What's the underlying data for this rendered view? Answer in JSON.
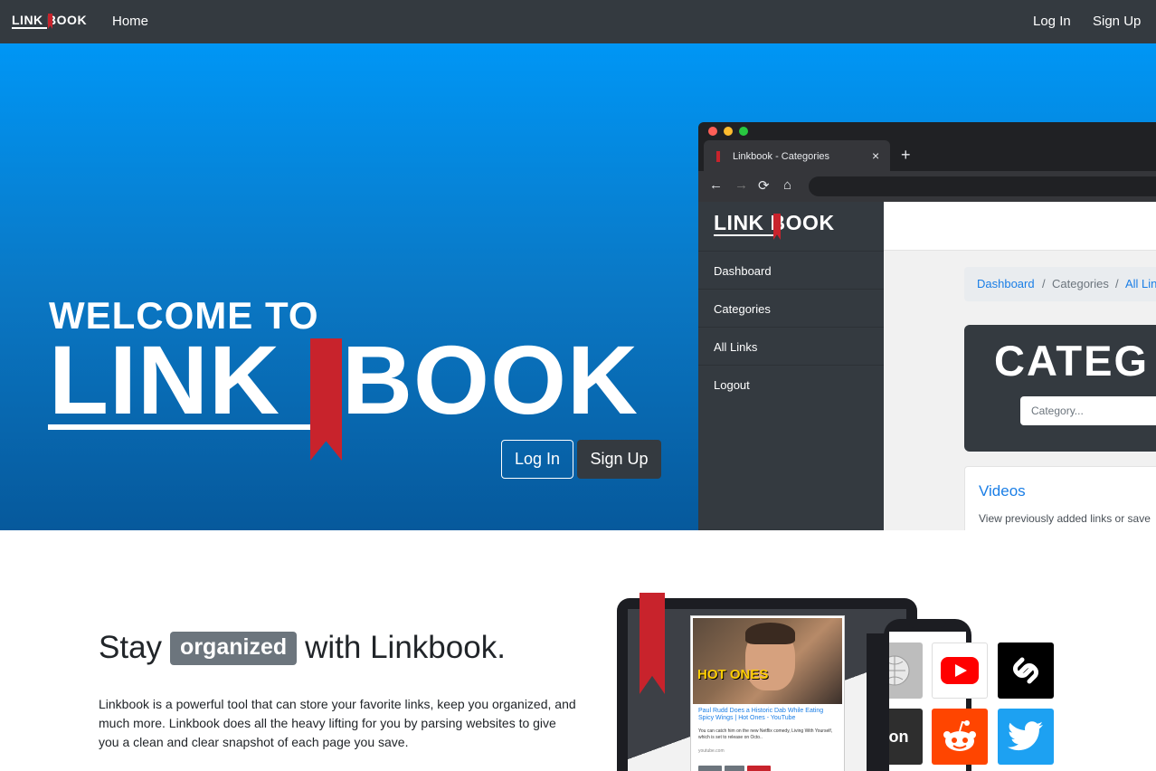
{
  "navbar": {
    "brand": "LINK BOOK",
    "home": "Home",
    "login": "Log In",
    "signup": "Sign Up"
  },
  "hero": {
    "welcome": "WELCOME TO",
    "title_left": "LINK",
    "title_right": "BOOK",
    "login_button": "Log In",
    "signup_button": "Sign Up"
  },
  "browser": {
    "tab_title": "Linkbook - Categories",
    "tab_close": "×",
    "new_tab": "+",
    "back_icon": "←",
    "forward_icon": "→",
    "reload_icon": "⟳",
    "home_icon": "⌂",
    "brand": "LINK BOOK",
    "sidebar": [
      "Dashboard",
      "Categories",
      "All Links",
      "Logout"
    ],
    "breadcrumb": [
      "Dashboard",
      "/",
      "Categories",
      "/",
      "All Lin"
    ],
    "category_title": "CATEG",
    "category_placeholder": "Category...",
    "card_title": "Videos",
    "card_text": "View previously added links or save"
  },
  "section": {
    "headline_pre": "Stay",
    "headline_badge": "organized",
    "headline_post": "with Linkbook.",
    "paragraph": "Linkbook is a powerful tool that can store your favorite links, keep you organized, and much more. Linkbook does all the heavy lifting for you by parsing websites to give you a clean and clear snapshot of each page you save."
  },
  "illustration": {
    "card_image_text": "HOT ONES",
    "card_title": "Paul Rudd Does a Historic Dab While Eating Spicy Wings | Hot Ones - YouTube",
    "card_text": "You can catch him on the new Netflix comedy, Living With Yourself, which is set to release on Octo..",
    "card_source": "youtube.com",
    "amazon_partial": "zon"
  },
  "colors": {
    "navbar_bg": "#343a40",
    "hero_top": "#0096f5",
    "hero_bottom": "#06599c",
    "brand_red": "#c8232c",
    "link_blue": "#1a7ee6"
  },
  "icons": {
    "youtube": "youtube-icon",
    "chain": "chain-link-icon",
    "reddit": "reddit-icon",
    "twitter": "twitter-icon",
    "wikipedia": "wikipedia-icon"
  }
}
